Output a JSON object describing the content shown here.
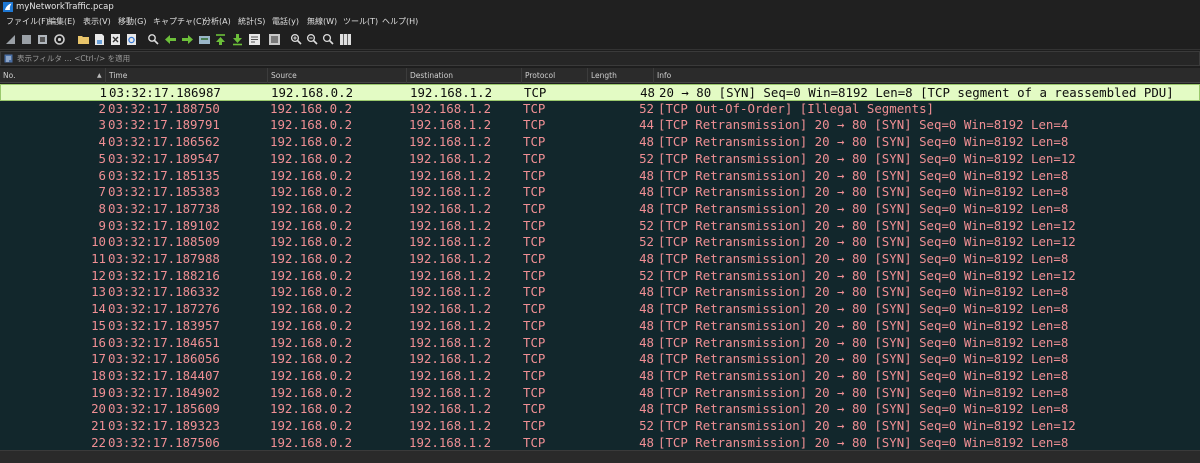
{
  "window": {
    "title": "myNetworkTraffic.pcap"
  },
  "menu": [
    "ファイル(F)",
    "編集(E)",
    "表示(V)",
    "移動(G)",
    "キャプチャ(C)",
    "分析(A)",
    "統計(S)",
    "電話(y)",
    "無線(W)",
    "ツール(T)",
    "ヘルプ(H)"
  ],
  "filter": {
    "placeholder": "表示フィルタ … <Ctrl-/> を適用"
  },
  "columns": {
    "no": "No.",
    "time": "Time",
    "source": "Source",
    "destination": "Destination",
    "protocol": "Protocol",
    "length": "Length",
    "info": "Info"
  },
  "colors": {
    "selected_bg": "#e3fbc4",
    "row_text": "#f08f94",
    "list_bg": "#12272c"
  },
  "packets": [
    {
      "no": "1",
      "time": "03:32:17.186987",
      "src": "192.168.0.2",
      "dst": "192.168.1.2",
      "proto": "TCP",
      "len": "48",
      "info": "20 → 80 [SYN] Seq=0 Win=8192 Len=8 [TCP segment of a reassembled PDU]"
    },
    {
      "no": "2",
      "time": "03:32:17.188750",
      "src": "192.168.0.2",
      "dst": "192.168.1.2",
      "proto": "TCP",
      "len": "52",
      "info": "[TCP Out-Of-Order] [Illegal Segments]"
    },
    {
      "no": "3",
      "time": "03:32:17.189791",
      "src": "192.168.0.2",
      "dst": "192.168.1.2",
      "proto": "TCP",
      "len": "44",
      "info": "[TCP Retransmission] 20 → 80 [SYN] Seq=0 Win=8192 Len=4"
    },
    {
      "no": "4",
      "time": "03:32:17.186562",
      "src": "192.168.0.2",
      "dst": "192.168.1.2",
      "proto": "TCP",
      "len": "48",
      "info": "[TCP Retransmission] 20 → 80 [SYN] Seq=0 Win=8192 Len=8"
    },
    {
      "no": "5",
      "time": "03:32:17.189547",
      "src": "192.168.0.2",
      "dst": "192.168.1.2",
      "proto": "TCP",
      "len": "52",
      "info": "[TCP Retransmission] 20 → 80 [SYN] Seq=0 Win=8192 Len=12"
    },
    {
      "no": "6",
      "time": "03:32:17.185135",
      "src": "192.168.0.2",
      "dst": "192.168.1.2",
      "proto": "TCP",
      "len": "48",
      "info": "[TCP Retransmission] 20 → 80 [SYN] Seq=0 Win=8192 Len=8"
    },
    {
      "no": "7",
      "time": "03:32:17.185383",
      "src": "192.168.0.2",
      "dst": "192.168.1.2",
      "proto": "TCP",
      "len": "48",
      "info": "[TCP Retransmission] 20 → 80 [SYN] Seq=0 Win=8192 Len=8"
    },
    {
      "no": "8",
      "time": "03:32:17.187738",
      "src": "192.168.0.2",
      "dst": "192.168.1.2",
      "proto": "TCP",
      "len": "48",
      "info": "[TCP Retransmission] 20 → 80 [SYN] Seq=0 Win=8192 Len=8"
    },
    {
      "no": "9",
      "time": "03:32:17.189102",
      "src": "192.168.0.2",
      "dst": "192.168.1.2",
      "proto": "TCP",
      "len": "52",
      "info": "[TCP Retransmission] 20 → 80 [SYN] Seq=0 Win=8192 Len=12"
    },
    {
      "no": "10",
      "time": "03:32:17.188509",
      "src": "192.168.0.2",
      "dst": "192.168.1.2",
      "proto": "TCP",
      "len": "52",
      "info": "[TCP Retransmission] 20 → 80 [SYN] Seq=0 Win=8192 Len=12"
    },
    {
      "no": "11",
      "time": "03:32:17.187988",
      "src": "192.168.0.2",
      "dst": "192.168.1.2",
      "proto": "TCP",
      "len": "48",
      "info": "[TCP Retransmission] 20 → 80 [SYN] Seq=0 Win=8192 Len=8"
    },
    {
      "no": "12",
      "time": "03:32:17.188216",
      "src": "192.168.0.2",
      "dst": "192.168.1.2",
      "proto": "TCP",
      "len": "52",
      "info": "[TCP Retransmission] 20 → 80 [SYN] Seq=0 Win=8192 Len=12"
    },
    {
      "no": "13",
      "time": "03:32:17.186332",
      "src": "192.168.0.2",
      "dst": "192.168.1.2",
      "proto": "TCP",
      "len": "48",
      "info": "[TCP Retransmission] 20 → 80 [SYN] Seq=0 Win=8192 Len=8"
    },
    {
      "no": "14",
      "time": "03:32:17.187276",
      "src": "192.168.0.2",
      "dst": "192.168.1.2",
      "proto": "TCP",
      "len": "48",
      "info": "[TCP Retransmission] 20 → 80 [SYN] Seq=0 Win=8192 Len=8"
    },
    {
      "no": "15",
      "time": "03:32:17.183957",
      "src": "192.168.0.2",
      "dst": "192.168.1.2",
      "proto": "TCP",
      "len": "48",
      "info": "[TCP Retransmission] 20 → 80 [SYN] Seq=0 Win=8192 Len=8"
    },
    {
      "no": "16",
      "time": "03:32:17.184651",
      "src": "192.168.0.2",
      "dst": "192.168.1.2",
      "proto": "TCP",
      "len": "48",
      "info": "[TCP Retransmission] 20 → 80 [SYN] Seq=0 Win=8192 Len=8"
    },
    {
      "no": "17",
      "time": "03:32:17.186056",
      "src": "192.168.0.2",
      "dst": "192.168.1.2",
      "proto": "TCP",
      "len": "48",
      "info": "[TCP Retransmission] 20 → 80 [SYN] Seq=0 Win=8192 Len=8"
    },
    {
      "no": "18",
      "time": "03:32:17.184407",
      "src": "192.168.0.2",
      "dst": "192.168.1.2",
      "proto": "TCP",
      "len": "48",
      "info": "[TCP Retransmission] 20 → 80 [SYN] Seq=0 Win=8192 Len=8"
    },
    {
      "no": "19",
      "time": "03:32:17.184902",
      "src": "192.168.0.2",
      "dst": "192.168.1.2",
      "proto": "TCP",
      "len": "48",
      "info": "[TCP Retransmission] 20 → 80 [SYN] Seq=0 Win=8192 Len=8"
    },
    {
      "no": "20",
      "time": "03:32:17.185609",
      "src": "192.168.0.2",
      "dst": "192.168.1.2",
      "proto": "TCP",
      "len": "48",
      "info": "[TCP Retransmission] 20 → 80 [SYN] Seq=0 Win=8192 Len=8"
    },
    {
      "no": "21",
      "time": "03:32:17.189323",
      "src": "192.168.0.2",
      "dst": "192.168.1.2",
      "proto": "TCP",
      "len": "52",
      "info": "[TCP Retransmission] 20 → 80 [SYN] Seq=0 Win=8192 Len=12"
    },
    {
      "no": "22",
      "time": "03:32:17.187506",
      "src": "192.168.0.2",
      "dst": "192.168.1.2",
      "proto": "TCP",
      "len": "48",
      "info": "[TCP Retransmission] 20 → 80 [SYN] Seq=0 Win=8192 Len=8"
    }
  ],
  "toolbar": [
    "start-capture-icon",
    "stop-capture-icon",
    "restart-capture-icon",
    "capture-options-icon",
    "open-file-icon",
    "save-file-icon",
    "close-file-icon",
    "reload-icon",
    "find-icon",
    "go-back-icon",
    "go-forward-icon",
    "go-to-packet-icon",
    "first-packet-icon",
    "last-packet-icon",
    "auto-scroll-icon",
    "colorize-icon",
    "zoom-in-icon",
    "zoom-out-icon",
    "normal-size-icon",
    "resize-columns-icon"
  ]
}
